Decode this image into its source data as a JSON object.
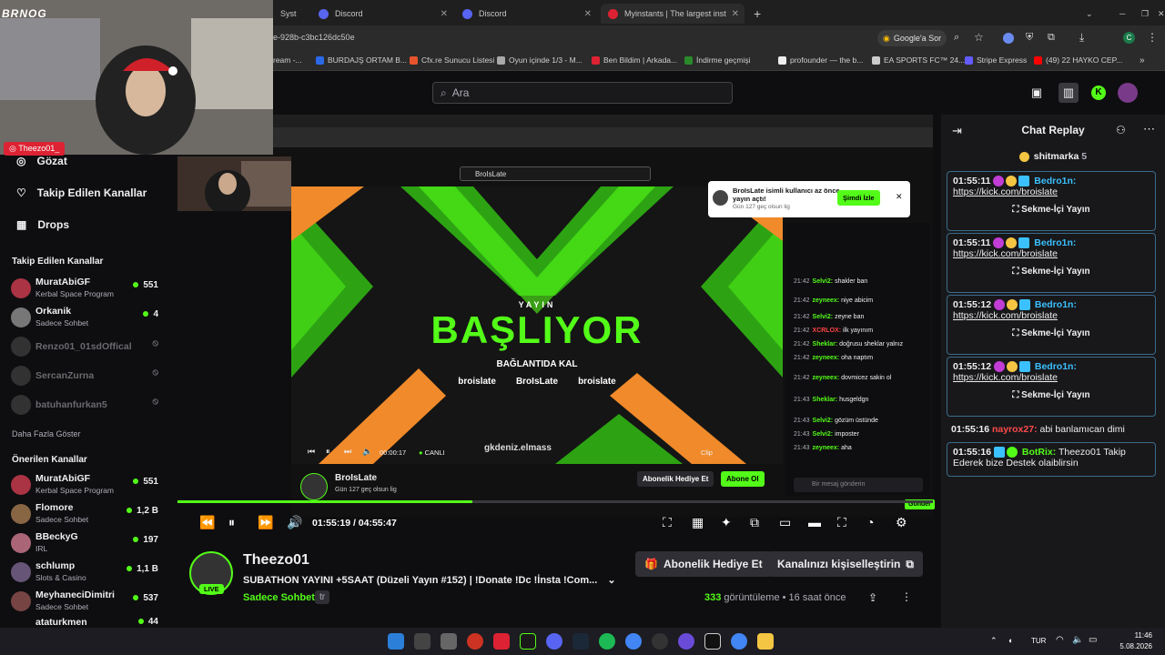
{
  "browser": {
    "tabs": [
      {
        "label": "Syst",
        "color": "#555"
      },
      {
        "label": "Discord",
        "color": "#5865f2"
      },
      {
        "label": "Discord",
        "color": "#5865f2"
      },
      {
        "label": "Myinstants | The largest instant",
        "color": "#d23"
      }
    ],
    "url": "e-928b-c3bc126dc50e",
    "google_btn": "Google'a Sor",
    "bookmarks": [
      {
        "label": "ream -...",
        "color": "#888"
      },
      {
        "label": "BURDAJŞ ORTAM B...",
        "color": "#2a6ae9"
      },
      {
        "label": "Cfx.re Sunucu Listesi",
        "color": "#e8542b"
      },
      {
        "label": "Oyun içinde 1/3 - M...",
        "color": "#aaa"
      },
      {
        "label": "Ben Bildim | Arkada...",
        "color": "#d23"
      },
      {
        "label": "İndirme geçmişi",
        "color": "#2a8a2a"
      },
      {
        "label": "profounder — the b...",
        "color": "#eee"
      },
      {
        "label": "EA SPORTS FC™ 24...",
        "color": "#ccc"
      },
      {
        "label": "Stripe Express",
        "color": "#635bff"
      },
      {
        "label": "(49) 22 HAYKO CEP...",
        "color": "#f00"
      }
    ]
  },
  "header": {
    "search_placeholder": "Ara"
  },
  "webcam": {
    "label": "Theezo01_",
    "logo": "BRNOG"
  },
  "sidebar": {
    "nav": [
      {
        "label": "Gözat",
        "icon": "compass-icon"
      },
      {
        "label": "Takip Edilen Kanallar",
        "icon": "heart-icon"
      },
      {
        "label": "Drops",
        "icon": "drops-icon"
      }
    ],
    "followed_header": "Takip Edilen Kanallar",
    "followed": [
      {
        "name": "MuratAbiGF",
        "category": "Kerbal Space Program",
        "viewers": "551",
        "color": "#a34"
      },
      {
        "name": "Orkanik",
        "category": "Sadece Sohbet",
        "viewers": "4",
        "color": "#777"
      },
      {
        "name": "Renzo01_01sdOffical",
        "category": "",
        "viewers": "",
        "color": "#555",
        "off": true
      },
      {
        "name": "SercanZurna",
        "category": "",
        "viewers": "",
        "color": "#555",
        "off": true
      },
      {
        "name": "batuhanfurkan5",
        "category": "",
        "viewers": "",
        "color": "#555",
        "off": true
      }
    ],
    "more": "Daha Fazla Göster",
    "recommended_header": "Önerilen Kanallar",
    "recommended": [
      {
        "name": "MuratAbiGF",
        "category": "Kerbal Space Program",
        "viewers": "551",
        "color": "#a34"
      },
      {
        "name": "Flomore",
        "category": "Sadece Sohbet",
        "viewers": "1,2 B",
        "color": "#864"
      },
      {
        "name": "BBeckyG",
        "category": "IRL",
        "viewers": "197",
        "color": "#a67"
      },
      {
        "name": "schlump",
        "category": "Slots & Casino",
        "viewers": "1,1 B",
        "color": "#657"
      },
      {
        "name": "MeyhaneciDimitri",
        "category": "Sadece Sohbet",
        "viewers": "537",
        "color": "#744"
      },
      {
        "name": "ataturkmen",
        "category": "",
        "viewers": "44",
        "color": "#555"
      }
    ]
  },
  "stream_overlay": {
    "small": "YAYIN",
    "title": "BAŞLIYOR",
    "subtitle": "BAĞLANTIDA KAL",
    "socials": [
      "broislate",
      "BroIsLate",
      "broislate"
    ],
    "inner_search": "BroIsLate",
    "watermark": "gkdeniz.elmass"
  },
  "inner_notification": {
    "text": "BroIsLate isimli kullanıcı az önce yayın açtı!",
    "sub": "Gün 127 geç olsun lig",
    "button": "Şimdi İzle"
  },
  "inner_player": {
    "time": "00:00:17",
    "live": "CANLI",
    "clip": "Clip",
    "streamer": "BroIsLate",
    "streamer_sub": "Gün 127 geç olsun lig",
    "gift": "Abonelik Hediye Et",
    "sub_btn": "Abone Ol",
    "inner_msg_placeholder": "Bir mesaj gönderin",
    "send": "Gönder"
  },
  "inner_chat": [
    {
      "t": "21:42",
      "u": "Selvi2:",
      "m": "shakler ban"
    },
    {
      "t": "21:42",
      "u": "zeyneex:",
      "m": "niye abicim"
    },
    {
      "t": "21:42",
      "u": "Selvi2:",
      "m": "zeyne ban"
    },
    {
      "t": "21:42",
      "u": "XCRLOX:",
      "m": "ilk yayınım"
    },
    {
      "t": "21:42",
      "u": "Sheklar:",
      "m": "doğrusu sheklar yalnız"
    },
    {
      "t": "21:42",
      "u": "zeyneex:",
      "m": "oha naptım"
    },
    {
      "t": "21:42",
      "u": "zeyneex:",
      "m": "dovmicez sakin ol"
    },
    {
      "t": "21:43",
      "u": "Sheklar:",
      "m": "husgeldgn"
    },
    {
      "t": "21:43",
      "u": "Selvi2:",
      "m": "gözüm üstünde"
    },
    {
      "t": "21:43",
      "u": "Selvi2:",
      "m": "imposter"
    },
    {
      "t": "21:43",
      "u": "zeyneex:",
      "m": "aha"
    }
  ],
  "player": {
    "time": "01:55:19 / 04:55:47",
    "progress": 0.39
  },
  "channel": {
    "name": "Theezo01",
    "live": "LIVE",
    "title": "SUBATHON YAYINI +5SAAT (Düzeli Yayın #152) | !Donate !Dc !İnsta !Com...",
    "category": "Sadece Sohbet",
    "lang": "tr",
    "gift_btn": "Abonelik Hediye Et",
    "custom_btn": "Kanalınızı kişiselleştirin",
    "views_num": "333",
    "views_label": "görüntüleme",
    "ago": "16 saat önce"
  },
  "chat": {
    "title": "Chat Replay",
    "pinned_user": "shitmarka",
    "pinned_count": "5",
    "messages": [
      {
        "ts": "01:55:11",
        "user": "Bedro1n:",
        "text": "https://kick.com/broislate",
        "embed": "Sekme-İçi Yayın"
      },
      {
        "ts": "01:55:11",
        "user": "Bedro1n:",
        "text": "https://kick.com/broislate",
        "embed": "Sekme-İçi Yayın"
      },
      {
        "ts": "01:55:12",
        "user": "Bedro1n:",
        "text": "https://kick.com/broislate",
        "embed": "Sekme-İçi Yayın"
      },
      {
        "ts": "01:55:12",
        "user": "Bedro1n:",
        "text": "https://kick.com/broislate",
        "embed": "Sekme-İçi Yayın"
      }
    ],
    "plain": {
      "ts": "01:55:16",
      "user": "nayrox27:",
      "text": "abi banlamıcan dimi"
    },
    "bot": {
      "ts": "01:55:16",
      "user": "BotRix:",
      "text": "Theezo01 Takip Ederek bize Destek olaiblirsin"
    }
  },
  "taskbar": {
    "lang": "TUR",
    "time": "11:46",
    "date": "5.08.2026"
  }
}
